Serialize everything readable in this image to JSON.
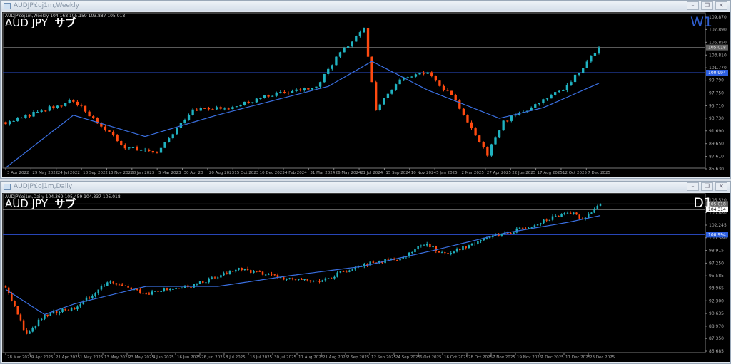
{
  "top": {
    "title": "AUDJPY.oj1m,Weekly",
    "info": "AUDJPY.oj1m,Weekly  104.168 105.159 103.887 105.018",
    "symbol": "AUD JPY",
    "sub": "サブ",
    "timeframe": "W1",
    "tf_color": "#2f5fd0",
    "price_axis": [
      "109.870",
      "107.890",
      "105.850",
      "103.810",
      "101.770",
      "99.790",
      "97.750",
      "95.710",
      "93.730",
      "91.690",
      "89.650",
      "87.610",
      "85.630"
    ],
    "price_range": [
      85.63,
      109.87
    ],
    "current_price": "105.018",
    "blue_line": "100.994",
    "dates": [
      "3 Apr 2022",
      "29 May 2022",
      "24 Jul 2022",
      "18 Sep 2022",
      "13 Nov 2022",
      "8 Jan 2023",
      "5 Mar 2023",
      "30 Apr 20",
      "20 Aug 2023",
      "15 Oct 2023",
      "10 Dec 2023",
      "4 Feb 2024",
      "31 Mar 2024",
      "26 May 2024",
      "21 Jul 2024",
      "15 Sep 2024",
      "10 Nov 2024",
      "5 Jan 2025",
      "2 Mar 2025",
      "27 Apr 2025",
      "22 Jun 2025",
      "17 Aug 2025",
      "12 Oct 2025",
      "7 Dec 2025"
    ],
    "bars": 150,
    "close_keypoints": [
      [
        0,
        93.1
      ],
      [
        6,
        94.2
      ],
      [
        17,
        96.6
      ],
      [
        22,
        93.7
      ],
      [
        30,
        89.2
      ],
      [
        38,
        88.0
      ],
      [
        47,
        95.2
      ],
      [
        56,
        95.2
      ],
      [
        67,
        97.5
      ],
      [
        78,
        98.6
      ],
      [
        83,
        103.4
      ],
      [
        90,
        107.9
      ],
      [
        93,
        95.2
      ],
      [
        99,
        99.7
      ],
      [
        106,
        101.1
      ],
      [
        113,
        96.6
      ],
      [
        121,
        88.0
      ],
      [
        125,
        93.2
      ],
      [
        132,
        95.4
      ],
      [
        141,
        98.8
      ],
      [
        149,
        105.0
      ]
    ],
    "ma_keypoints": [
      [
        0,
        85.8
      ],
      [
        17,
        94.2
      ],
      [
        35,
        90.8
      ],
      [
        53,
        94.2
      ],
      [
        81,
        98.8
      ],
      [
        92,
        102.8
      ],
      [
        106,
        98.2
      ],
      [
        124,
        93.7
      ],
      [
        135,
        95.4
      ],
      [
        149,
        99.3
      ]
    ]
  },
  "bottom": {
    "title": "AUDJPY.oj1m,Daily",
    "info": "AUDJPY.oj1m,Daily  104.369 105.459 104.337 105.018",
    "symbol": "AUD JPY",
    "sub": "サブ",
    "timeframe": "D1",
    "tf_color": "#ffffff",
    "price_axis": [
      "105.520",
      "103.880",
      "102.245",
      "100.580",
      "98.915",
      "97.250",
      "95.585",
      "93.965",
      "92.300",
      "90.635",
      "88.970",
      "87.350",
      "85.685"
    ],
    "price_range": [
      85.685,
      105.52
    ],
    "current_price": "105.018",
    "white_line": "104.314",
    "blue_line": "100.994",
    "dates": [
      "28 Mar 2025",
      "9 Apr 2025",
      "21 Apr 2025",
      "1 May 2025",
      "13 May 2025",
      "23 May 2025",
      "4 Jun 2025",
      "16 Jun 2025",
      "26 Jun 2025",
      "8 Jul 2025",
      "18 Jul 2025",
      "30 Jul 2025",
      "11 Aug 2025",
      "21 Aug 2025",
      "2 Sep 2025",
      "12 Sep 2025",
      "24 Sep 2025",
      "6 Oct 2025",
      "16 Oct 2025",
      "28 Oct 2025",
      "7 Nov 2025",
      "19 Nov 2025",
      "1 Dec 2025",
      "11 Dec 2025",
      "23 Dec 2025"
    ],
    "bars": 200,
    "close_keypoints": [
      [
        0,
        94.3
      ],
      [
        7,
        87.7
      ],
      [
        13,
        90.5
      ],
      [
        23,
        91.4
      ],
      [
        34,
        94.7
      ],
      [
        47,
        93.3
      ],
      [
        62,
        94.2
      ],
      [
        78,
        96.5
      ],
      [
        95,
        95.1
      ],
      [
        104,
        94.7
      ],
      [
        118,
        97.0
      ],
      [
        133,
        97.9
      ],
      [
        140,
        99.8
      ],
      [
        147,
        98.4
      ],
      [
        162,
        100.7
      ],
      [
        176,
        102.1
      ],
      [
        188,
        104.0
      ],
      [
        193,
        103.1
      ],
      [
        199,
        105.0
      ]
    ],
    "ma_keypoints": [
      [
        0,
        93.8
      ],
      [
        13,
        90.5
      ],
      [
        23,
        91.9
      ],
      [
        47,
        94.2
      ],
      [
        71,
        94.2
      ],
      [
        95,
        95.6
      ],
      [
        119,
        96.8
      ],
      [
        143,
        98.9
      ],
      [
        167,
        101.2
      ],
      [
        188,
        102.6
      ],
      [
        199,
        103.5
      ]
    ]
  },
  "colors": {
    "bull": "#20b2c0",
    "bear": "#ff4a10",
    "ma": "#3a6fe0",
    "grid_line": "#ffffff"
  }
}
